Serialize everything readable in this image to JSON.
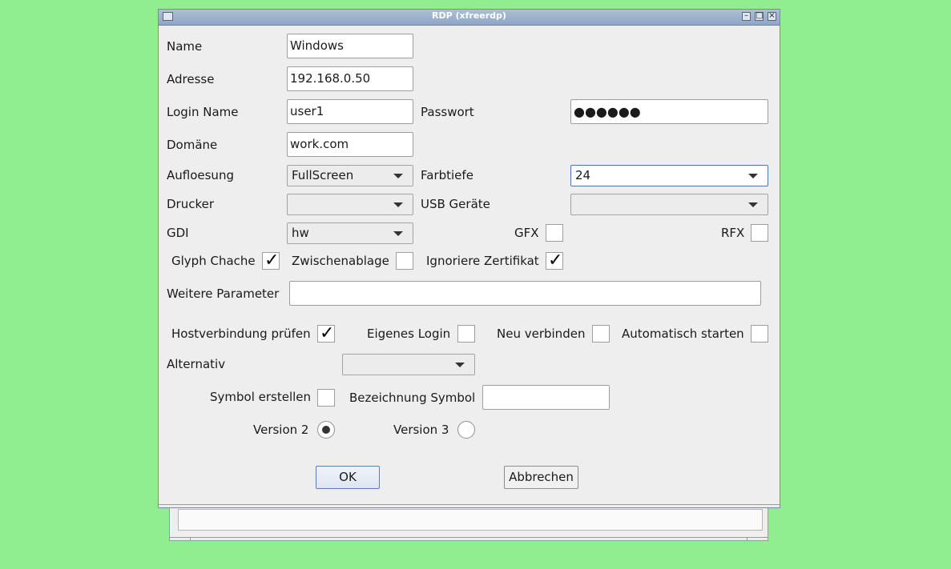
{
  "window": {
    "title": "RDP (xfreerdp)"
  },
  "titlebar_buttons": {
    "minimize": "–",
    "maximize": "□",
    "close": "×"
  },
  "fields": {
    "name": {
      "label": "Name",
      "value": "Windows"
    },
    "adresse": {
      "label": "Adresse",
      "value": "192.168.0.50"
    },
    "login": {
      "label": "Login Name",
      "value": "user1"
    },
    "passwort": {
      "label": "Passwort",
      "value": "●●●●●●"
    },
    "domaene": {
      "label": "Domäne",
      "value": "work.com"
    },
    "weitere": {
      "label": "Weitere Parameter",
      "value": ""
    },
    "bezeichnung": {
      "label": "Bezeichnung Symbol",
      "value": ""
    }
  },
  "combos": {
    "aufloesung": {
      "label": "Aufloesung",
      "value": "FullScreen"
    },
    "farbtiefe": {
      "label": "Farbtiefe",
      "value": "24"
    },
    "drucker": {
      "label": "Drucker",
      "value": ""
    },
    "usb": {
      "label": "USB Geräte",
      "value": ""
    },
    "gdi": {
      "label": "GDI",
      "value": "hw"
    },
    "alternativ": {
      "label": "Alternativ",
      "value": ""
    }
  },
  "checkboxes": {
    "gfx": {
      "label": "GFX",
      "checked": false
    },
    "rfx": {
      "label": "RFX",
      "checked": false
    },
    "glyph": {
      "label": "Glyph Chache",
      "checked": true
    },
    "zwischenablage": {
      "label": "Zwischenablage",
      "checked": false
    },
    "zertifikat": {
      "label": "Ignoriere Zertifikat",
      "checked": true
    },
    "hostverbindung": {
      "label": "Hostverbindung prüfen",
      "checked": true
    },
    "eigenes_login": {
      "label": "Eigenes Login",
      "checked": false
    },
    "neu_verbinden": {
      "label": "Neu verbinden",
      "checked": false
    },
    "auto_start": {
      "label": "Automatisch starten",
      "checked": false
    },
    "symbol": {
      "label": "Symbol erstellen",
      "checked": false
    }
  },
  "check_mark": "✓",
  "radios": {
    "version2": {
      "label": "Version 2",
      "selected": true
    },
    "version3": {
      "label": "Version 3",
      "selected": false
    }
  },
  "buttons": {
    "ok": "OK",
    "cancel": "Abbrechen"
  },
  "colors": {
    "desktop": "#90ee90",
    "dialog_bg": "#eeeeee",
    "titlebar": "#9fb3cf"
  }
}
